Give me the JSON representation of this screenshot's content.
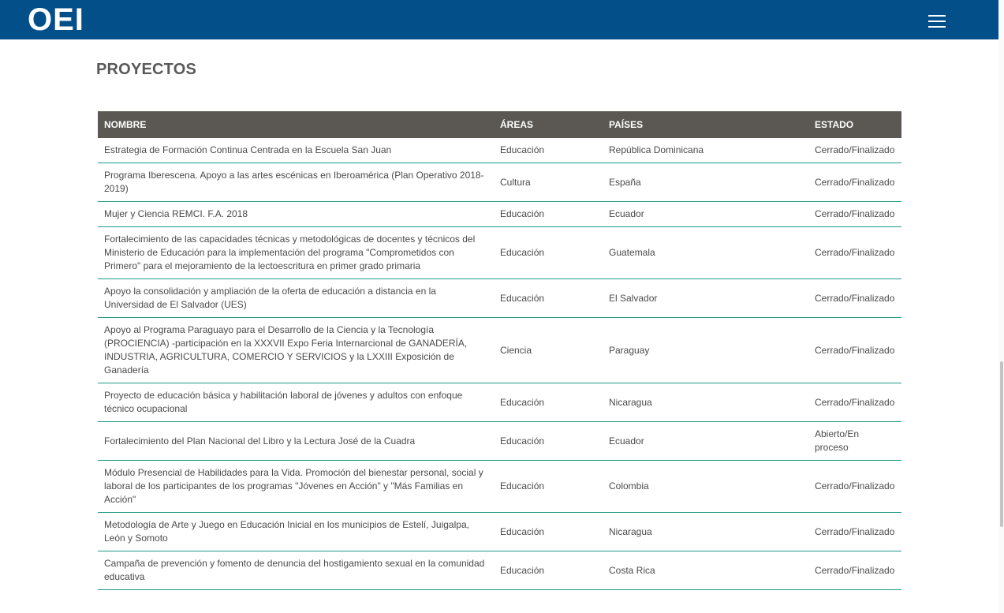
{
  "header": {
    "logo_text": "OEI",
    "menu_icon": "hamburger-menu-icon"
  },
  "page": {
    "title": "PROYECTOS"
  },
  "table": {
    "headers": {
      "name": "NOMBRE",
      "area": "ÁREAS",
      "country": "PAÍSES",
      "status": "ESTADO"
    },
    "rows": [
      {
        "name": "Estrategia de Formación Continua Centrada en la Escuela San Juan",
        "area": "Educación",
        "country": "República Dominicana",
        "status": "Cerrado/Finalizado"
      },
      {
        "name": "Programa Iberescena. Apoyo a las artes escénicas en Iberoamérica (Plan Operativo 2018-2019)",
        "area": "Cultura",
        "country": "España",
        "status": "Cerrado/Finalizado"
      },
      {
        "name": "Mujer y Ciencia REMCI. F.A. 2018",
        "area": "Educación",
        "country": "Ecuador",
        "status": "Cerrado/Finalizado"
      },
      {
        "name": "Fortalecimiento de las capacidades técnicas y metodológicas de docentes y técnicos del Ministerio de Educación para la implementación del programa \"Comprometidos con Primero\" para el mejoramiento de la lectoescritura en primer grado primaria",
        "area": "Educación",
        "country": "Guatemala",
        "status": "Cerrado/Finalizado"
      },
      {
        "name": "Apoyo la consolidación y ampliación de la oferta de educación a distancia en la Universidad de El Salvador (UES)",
        "area": "Educación",
        "country": "El Salvador",
        "status": "Cerrado/Finalizado"
      },
      {
        "name": "Apoyo al Programa Paraguayo para el Desarrollo de la Ciencia y la Tecnología (PROCIENCIA) -participación en la XXXVII Expo Feria Internarcional de GANADERÍA, INDUSTRIA, AGRICULTURA, COMERCIO Y SERVICIOS y la LXXIII Exposición de Ganadería",
        "area": "Ciencia",
        "country": "Paraguay",
        "status": "Cerrado/Finalizado"
      },
      {
        "name": "Proyecto de educación básica y habilitación laboral de jóvenes y adultos con enfoque técnico ocupacional",
        "area": "Educación",
        "country": "Nicaragua",
        "status": "Cerrado/Finalizado"
      },
      {
        "name": "Fortalecimiento del Plan Nacional del Libro y la Lectura José de la Cuadra",
        "area": "Educación",
        "country": "Ecuador",
        "status": "Abierto/En proceso"
      },
      {
        "name": "Módulo Presencial de Habilidades para la Vida. Promoción del bienestar personal, social y laboral de los participantes de los programas \"Jóvenes en Acción\" y \"Más Familias en Acción\"",
        "area": "Educación",
        "country": "Colombia",
        "status": "Cerrado/Finalizado"
      },
      {
        "name": "Metodología de Arte y Juego en Educación Inicial en los municipios de Estelí, Juigalpa, León y Somoto",
        "area": "Educación",
        "country": "Nicaragua",
        "status": "Cerrado/Finalizado"
      },
      {
        "name": "Campaña de prevención y fomento de denuncia del hostigamiento sexual en la comunidad educativa",
        "area": "Educación",
        "country": "Costa Rica",
        "status": "Cerrado/Finalizado"
      }
    ]
  }
}
